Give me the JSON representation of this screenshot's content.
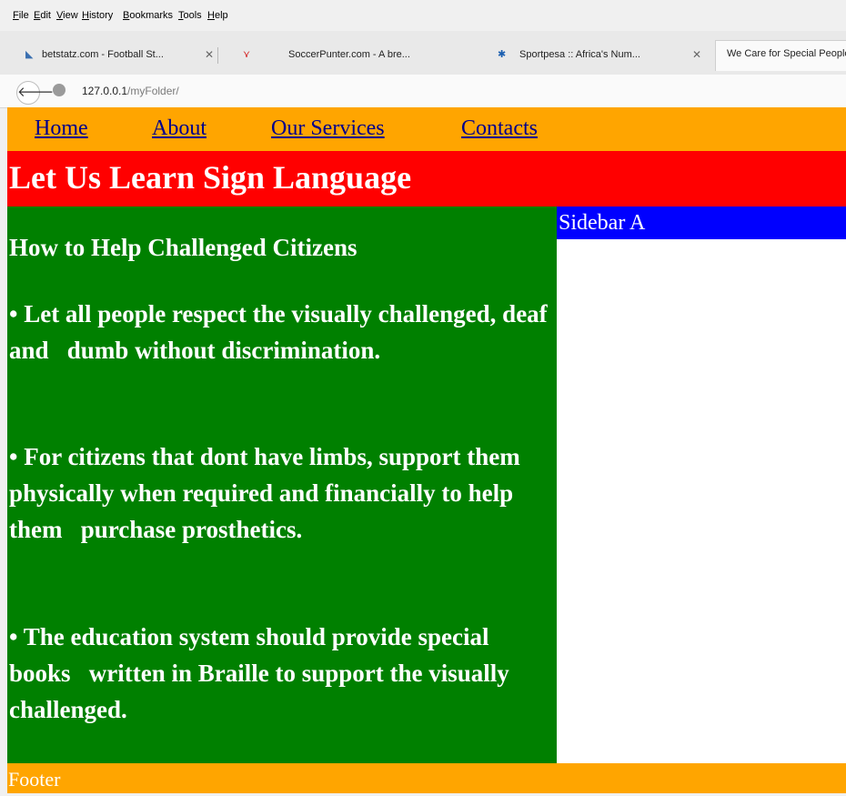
{
  "menu": [
    "File",
    "Edit",
    "View",
    "History",
    "Bookmarks",
    "Tools",
    "Help"
  ],
  "tabs": [
    {
      "label": "betstatz.com - Football St...",
      "close": "✕",
      "icon": "chart-icon"
    },
    {
      "label": "SoccerPunter.com - A bre...",
      "close": "✕",
      "icon": "pulse-icon"
    },
    {
      "label": "Sportpesa :: Africa's Num...",
      "close": "✕",
      "icon": "sportpesa-icon"
    },
    {
      "label": "We Care for Special People",
      "close": "",
      "icon": ""
    }
  ],
  "address": {
    "host": "127.0.0.1",
    "path": "/myFolder/"
  },
  "site": {
    "nav": [
      "Home",
      "About",
      "Our Services",
      "Contacts"
    ],
    "header_title": "Let Us Learn Sign Language",
    "main_heading": "How to Help Challenged Citizens",
    "paragraphs": [
      "• Let all people respect the visually challenged, deaf and   dumb without discrimination.",
      "• For citizens that dont have limbs, support them   physically when required and financially to help them   purchase prosthetics.",
      "• The education system should provide special books   written in Braille to support the visually challenged."
    ],
    "sidebar_title": "Sidebar A",
    "footer": "Footer"
  },
  "colors": {
    "nav_bg": "#ffa500",
    "header_bg": "#ff0000",
    "main_bg": "#008000",
    "sidebar_title_bg": "#0000ff",
    "footer_bg": "#ffa500"
  }
}
